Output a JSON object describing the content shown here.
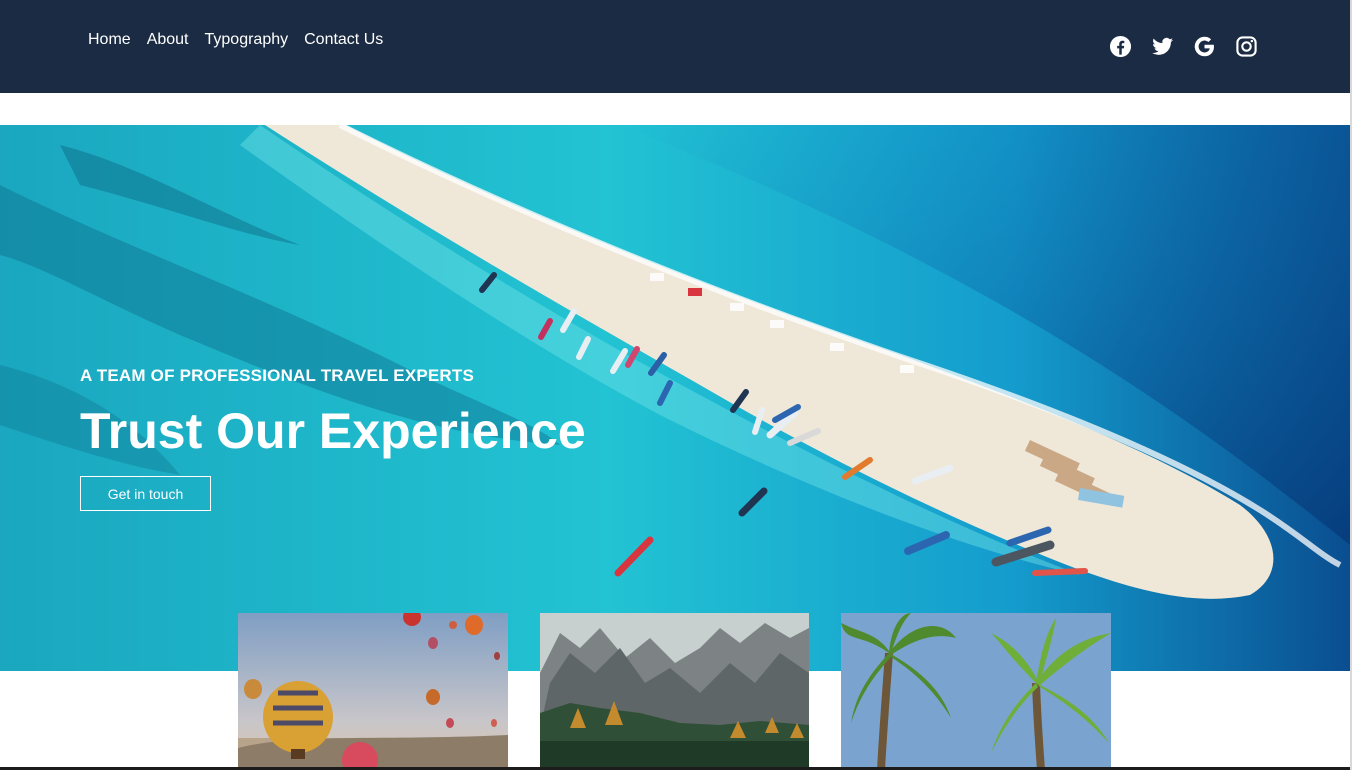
{
  "nav": {
    "items": [
      {
        "label": "Home"
      },
      {
        "label": "About"
      },
      {
        "label": "Typography"
      },
      {
        "label": "Contact Us"
      }
    ]
  },
  "social": {
    "icons": [
      "facebook-icon",
      "twitter-icon",
      "google-icon",
      "instagram-icon"
    ]
  },
  "hero": {
    "eyebrow": "A TEAM OF PROFESSIONAL TRAVEL EXPERTS",
    "headline": "Trust Our Experience",
    "cta_label": "Get in touch"
  },
  "cards": [
    {
      "image": "hot-air-balloons"
    },
    {
      "image": "mountain-range"
    },
    {
      "image": "palm-trees"
    }
  ],
  "colors": {
    "header_bg": "#1b2b43",
    "text_light": "#ffffff",
    "sea": "#1fb6c9",
    "deep_sea": "#0a4f8f",
    "sand": "#efe7d8"
  }
}
